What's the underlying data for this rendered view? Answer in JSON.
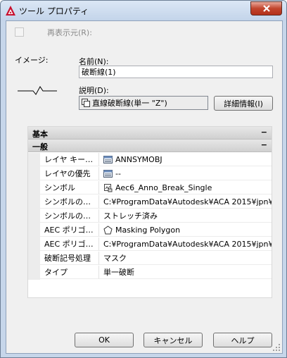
{
  "window": {
    "title": "ツール プロパティ"
  },
  "redisplay": {
    "label": "再表示元(R):",
    "checked": false
  },
  "image_label": "イメージ:",
  "name": {
    "label": "名前(N):",
    "value": "破断線(1)"
  },
  "description": {
    "label": "説明(D):",
    "value": "直線破断線(単一 \"Z\")"
  },
  "detail_button": "詳細情報(I)",
  "grid": {
    "categories": [
      {
        "label": "基本",
        "toggle": "−"
      },
      {
        "label": "一般",
        "toggle": "−"
      }
    ],
    "rows": [
      {
        "name": "レイヤ キー…",
        "value": "ANNSYMOBJ",
        "icon": "list-icon"
      },
      {
        "name": "レイヤの優先",
        "value": "--",
        "icon": "list-icon"
      },
      {
        "name": "シンボル",
        "value": "Aec6_Anno_Break_Single",
        "icon": "block-symbol-icon"
      },
      {
        "name": "シンボルの…",
        "value": "C:¥ProgramData¥Autodesk¥ACA  2015¥jpn¥…",
        "icon": ""
      },
      {
        "name": "シンボルの…",
        "value": "ストレッチ済み",
        "icon": ""
      },
      {
        "name": "AEC ポリゴ…",
        "value": "Masking Polygon",
        "icon": "pentagon-icon"
      },
      {
        "name": "AEC ポリゴ…",
        "value": "C:¥ProgramData¥Autodesk¥ACA  2015¥jpn¥…",
        "icon": ""
      },
      {
        "name": "破断記号処理",
        "value": "マスク",
        "icon": ""
      },
      {
        "name": "タイプ",
        "value": "単一破断",
        "icon": ""
      }
    ]
  },
  "buttons": {
    "ok": "OK",
    "cancel": "キャンセル",
    "help": "ヘルプ"
  },
  "colors": {
    "title_gradient_top": "#dbe7f5",
    "close_button": "#c2452d",
    "accent_red": "#c8102e"
  }
}
